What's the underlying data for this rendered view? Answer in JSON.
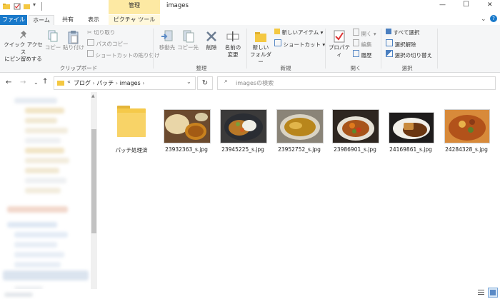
{
  "window": {
    "title": "images",
    "context_tab_group": "管理",
    "minimize": "—",
    "maximize": "☐",
    "close": "✕",
    "help": "?"
  },
  "ribbon_tabs": [
    {
      "label": "ファイル"
    },
    {
      "label": "ホーム"
    },
    {
      "label": "共有"
    },
    {
      "label": "表示"
    },
    {
      "label": "ピクチャ ツール"
    }
  ],
  "clipboard": {
    "group_label": "クリップボード",
    "pin_label_1": "クイック アクセス",
    "pin_label_2": "にピン留めする",
    "copy": "コピー",
    "paste": "貼り付け",
    "cut": "切り取り",
    "copy_path": "パスのコピー",
    "paste_shortcut": "ショートカットの貼り付け"
  },
  "organize": {
    "group_label": "整理",
    "move_to": "移動先",
    "copy_to": "コピー先",
    "delete": "削除",
    "rename_1": "名前の",
    "rename_2": "変更"
  },
  "new": {
    "group_label": "新規",
    "new_folder_1": "新しい",
    "new_folder_2": "フォルダー",
    "new_item": "新しいアイテム ▾",
    "shortcut": "ショートカット ▾"
  },
  "open": {
    "group_label": "開く",
    "properties": "プロパティ",
    "open": "開く ▾",
    "edit": "編集",
    "history": "履歴"
  },
  "select": {
    "group_label": "選択",
    "select_all": "すべて選択",
    "select_none": "選択解除",
    "invert": "選択の切り替え"
  },
  "address": {
    "prefix": "«",
    "crumbs": [
      "ブログ",
      "パッチ",
      "images"
    ],
    "search_placeholder": "imagesの検索"
  },
  "files": [
    {
      "name": "パッチ処理済",
      "type": "folder"
    },
    {
      "name": "23932363_s.jpg",
      "type": "image",
      "icon": "naan-curry-photo"
    },
    {
      "name": "23945225_s.jpg",
      "type": "image",
      "icon": "curry-plate-photo"
    },
    {
      "name": "23952752_s.jpg",
      "type": "image",
      "icon": "curry-bowl-photo"
    },
    {
      "name": "23986901_s.jpg",
      "type": "image",
      "icon": "vegetable-curry-photo"
    },
    {
      "name": "24169861_s.jpg",
      "type": "image",
      "icon": "katsu-curry-photo"
    },
    {
      "name": "24284328_s.jpg",
      "type": "image",
      "icon": "soup-curry-photo"
    }
  ],
  "colors": {
    "file_tab": "#1979ca",
    "context_tab": "#fde9a3",
    "folder": "#f4c842"
  }
}
